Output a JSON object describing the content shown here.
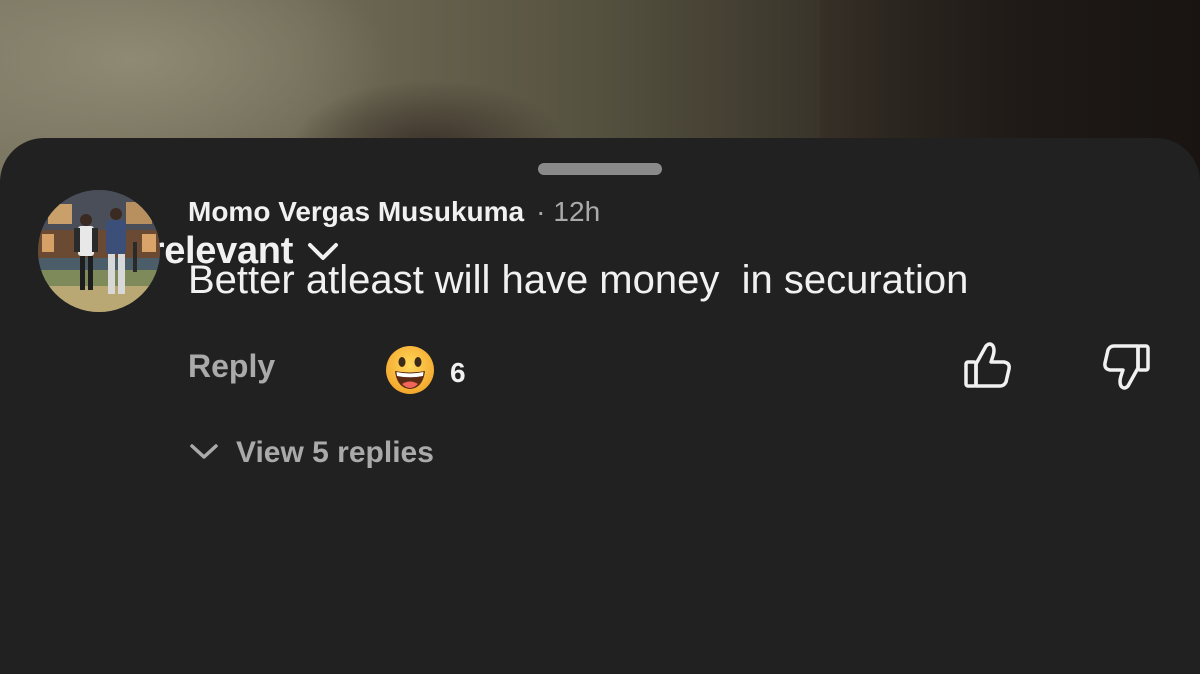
{
  "sort": {
    "label": "Most relevant",
    "icon": "chevron-down-icon"
  },
  "comment": {
    "author": "Momo Vergas Musukuma",
    "separator": "·",
    "time": "12h",
    "text": "Better atleast will have money  in securation",
    "reply_label": "Reply",
    "reaction": {
      "icon": "grinning-face-emoji-icon",
      "count": "6"
    },
    "like_icon": "thumbs-up-icon",
    "dislike_icon": "thumbs-down-icon"
  },
  "replies": {
    "label": "View 5 replies",
    "icon": "chevron-down-icon"
  },
  "colors": {
    "sheet_bg": "#212121",
    "primary_text": "#f1f1f1",
    "secondary_text": "#aaaaaa",
    "handle": "#8a8a8a",
    "emoji_yellow": "#f7b733"
  }
}
